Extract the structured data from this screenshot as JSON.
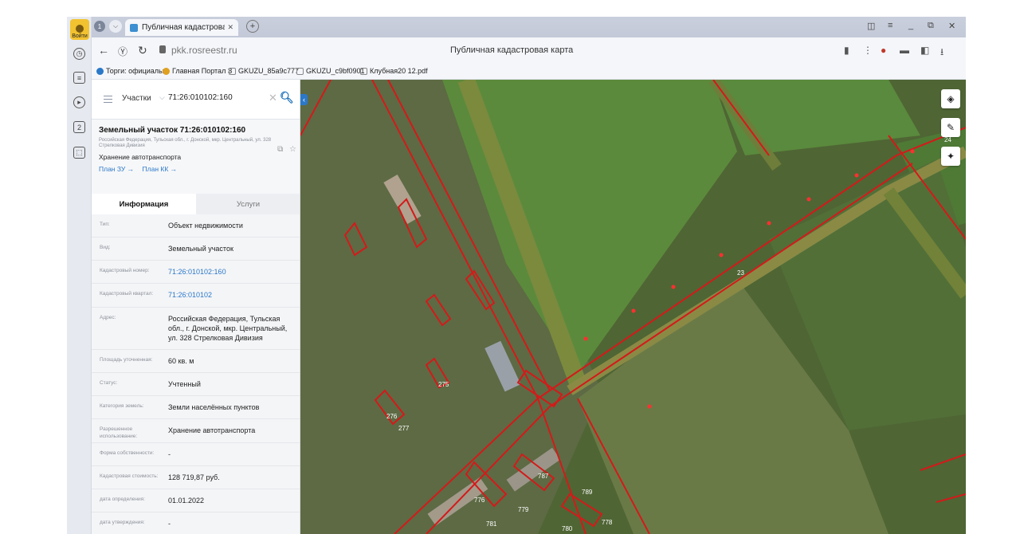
{
  "browser": {
    "login_label": "Войти",
    "tab_count": "1",
    "tab_title": "Публичная кадастрова",
    "url": "pkk.rosreestr.ru",
    "page_title": "Публичная кадастровая карта",
    "rail_badge": "2",
    "bookmarks": [
      {
        "label": "Торги: официальн",
        "icon_color": "#2b78c8"
      },
      {
        "label": "Главная Портал З",
        "icon_color": "#e0a020"
      },
      {
        "label": "GKUZU_85a9c777",
        "icon_color": "#9aa0aa"
      },
      {
        "label": "GKUZU_c9bf0901",
        "icon_color": "#9aa0aa"
      },
      {
        "label": "Клубная20 12.pdf",
        "icon_color": "#9aa0aa"
      }
    ]
  },
  "search": {
    "type_label": "Участки",
    "query": "71:26:010102:160"
  },
  "card": {
    "title": "Земельный участок 71:26:010102:160",
    "address_small": "Российская Федерация, Тульская обл., г. Донской, мкр. Центральный, ул. 328 Стрелковая Дивизия",
    "usage": "Хранение автотранспорта",
    "link_plan_zu": "План ЗУ →",
    "link_plan_kk": "План КК →"
  },
  "tabs": {
    "info": "Информация",
    "services": "Услуги"
  },
  "attributes": [
    {
      "key": "Тип:",
      "value": "Объект недвижимости",
      "link": false
    },
    {
      "key": "Вид:",
      "value": "Земельный участок",
      "link": false
    },
    {
      "key": "Кадастровый номер:",
      "value": "71:26:010102:160",
      "link": true
    },
    {
      "key": "Кадастровый квартал:",
      "value": "71:26:010102",
      "link": true
    },
    {
      "key": "Адрес:",
      "value": "Российская Федерация, Тульская обл., г. Донской, мкр. Центральный, ул. 328 Стрелковая Дивизия",
      "link": false
    },
    {
      "key": "Площадь уточненная:",
      "value": "60 кв. м",
      "link": false
    },
    {
      "key": "Статус:",
      "value": "Учтенный",
      "link": false
    },
    {
      "key": "Категория земель:",
      "value": "Земли населённых пунктов",
      "link": false
    },
    {
      "key": "Разрешенное использование:",
      "value": "Хранение автотранспорта",
      "link": false
    },
    {
      "key": "Форма собственности:",
      "value": "-",
      "link": false
    },
    {
      "key": "Кадастровая стоимость:",
      "value": "128 719,87 руб.",
      "link": false
    },
    {
      "key": "дата определения:",
      "value": "01.01.2022",
      "link": false
    },
    {
      "key": "дата утверждения:",
      "value": "-",
      "link": false
    }
  ],
  "map_labels": [
    "787",
    "789",
    "779",
    "781",
    "780",
    "778",
    "776",
    "277",
    "276",
    "275",
    "23",
    "24"
  ]
}
